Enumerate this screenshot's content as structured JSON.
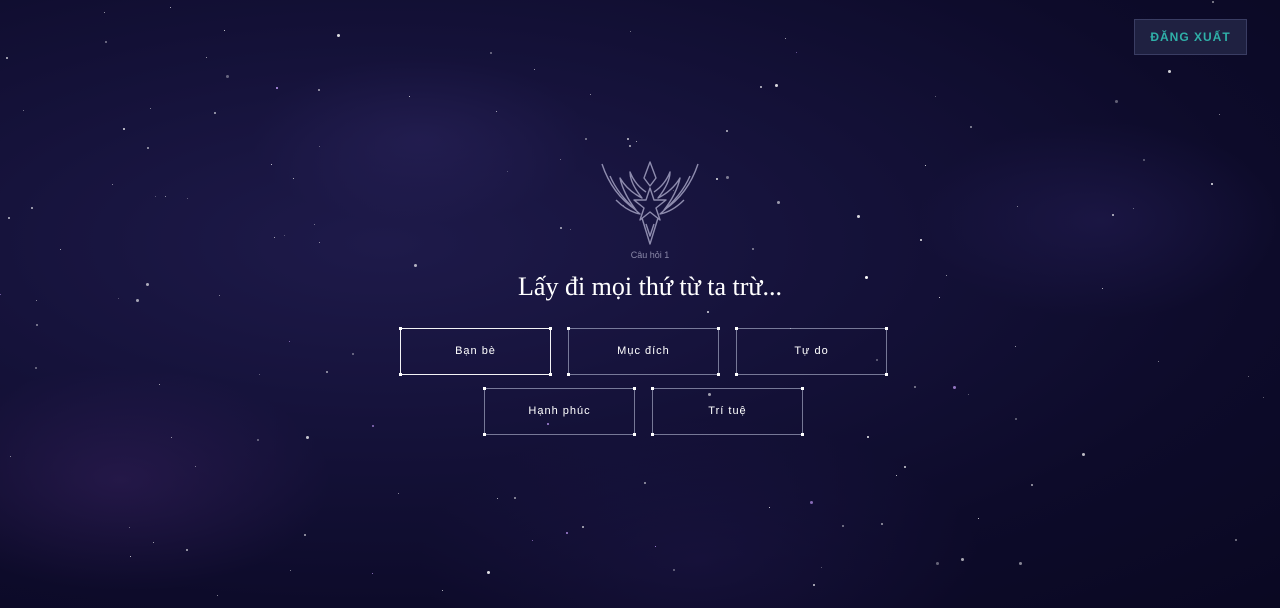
{
  "header": {
    "logout_label": "ĐĂNG XUẤT"
  },
  "quiz": {
    "question_number": "Câu hỏi 1",
    "question_text": "Lấy đi mọi thứ từ ta trừ...",
    "answers": [
      {
        "label": "Bạn bè",
        "selected": true
      },
      {
        "label": "Mục đích",
        "selected": false
      },
      {
        "label": "Tự do",
        "selected": false
      },
      {
        "label": "Hạnh phúc",
        "selected": false
      },
      {
        "label": "Trí tuệ",
        "selected": false
      }
    ]
  },
  "icons": {
    "emblem": "star-guardian-emblem-icon"
  },
  "colors": {
    "background": "#0d0b2a",
    "accent_teal": "#2fb0a8",
    "button_bg": "#1f2141"
  }
}
